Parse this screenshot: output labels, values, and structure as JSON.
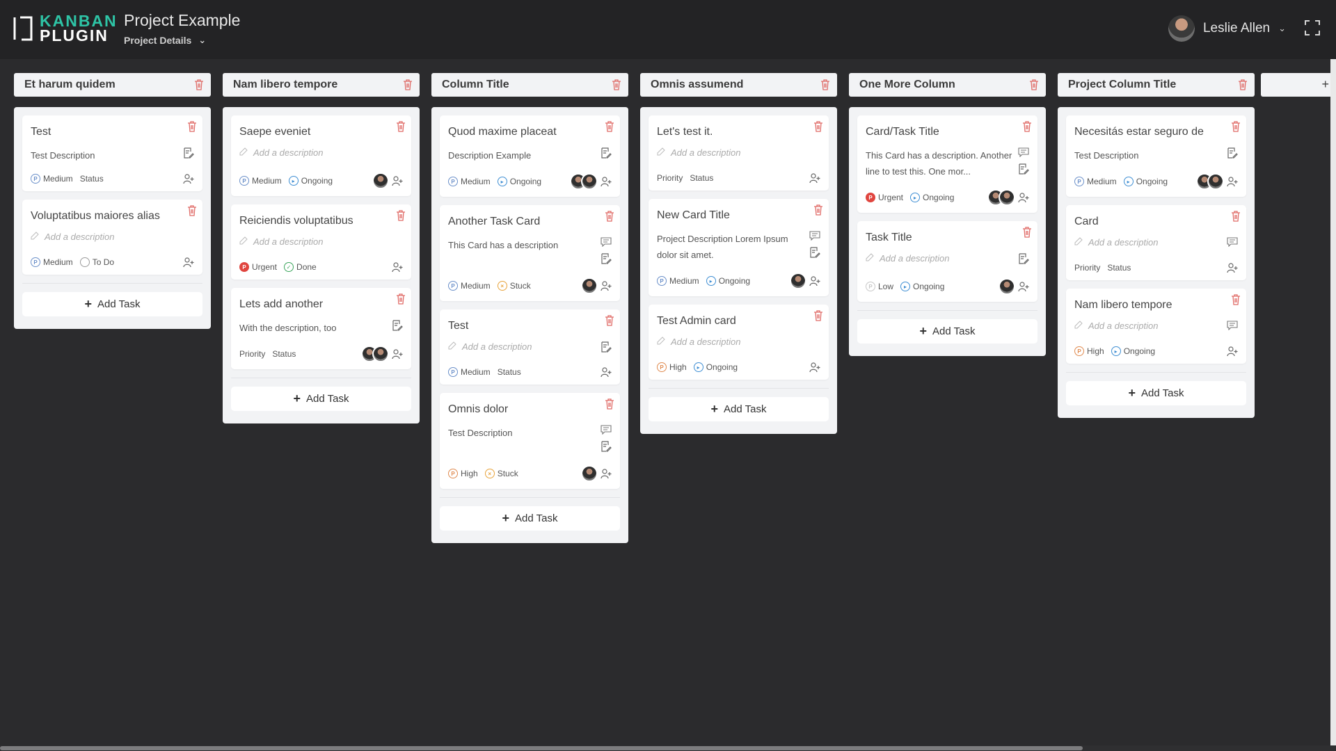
{
  "header": {
    "logo": {
      "line1": "KANBAN",
      "line2": "PLUGIN"
    },
    "project_title": "Project Example",
    "project_details": "Project Details",
    "user_name": "Leslie Allen"
  },
  "colors": {
    "background": "#2b2b2d",
    "header": "#232325",
    "accent": "#2ec4a6",
    "urgent": "#e0453f",
    "high": "#e08a4f",
    "medium": "#6a8fc9",
    "ongoing": "#3e8ed3",
    "done": "#3ba55c",
    "stuck": "#e8a33a"
  },
  "add_task_label": "Add Task",
  "placeholder_text": "Add a description",
  "columns": [
    {
      "title": "Et harum quidem",
      "cards": [
        {
          "title": "Test",
          "description": "Test Description",
          "priority": "Medium",
          "priority_level": "medium",
          "status": "Status",
          "status_level": "",
          "avatars": 0,
          "icons": [
            "note"
          ]
        },
        {
          "title": "Voluptatibus maiores alias",
          "description": "",
          "priority": "Medium",
          "priority_level": "medium",
          "status": "To Do",
          "status_level": "todo",
          "avatars": 0,
          "icons": []
        }
      ]
    },
    {
      "title": "Nam libero tempore",
      "cards": [
        {
          "title": "Saepe eveniet",
          "description": "",
          "priority": "Medium",
          "priority_level": "medium",
          "status": "Ongoing",
          "status_level": "ongoing",
          "avatars": 1,
          "icons": []
        },
        {
          "title": "Reiciendis voluptatibus",
          "description": "",
          "priority": "Urgent",
          "priority_level": "urgent",
          "status": "Done",
          "status_level": "done",
          "avatars": 0,
          "icons": []
        },
        {
          "title": "Lets add another",
          "description": "With the description, too",
          "priority": "Priority",
          "priority_level": "",
          "status": "Status",
          "status_level": "",
          "avatars": 2,
          "icons": [
            "note"
          ]
        }
      ]
    },
    {
      "title": "Column Title",
      "cards": [
        {
          "title": "Quod maxime placeat",
          "description": "Description Example",
          "priority": "Medium",
          "priority_level": "medium",
          "status": "Ongoing",
          "status_level": "ongoing",
          "avatars": 2,
          "icons": [
            "note"
          ]
        },
        {
          "title": "Another Task Card",
          "description": "This Card has a description",
          "priority": "Medium",
          "priority_level": "medium",
          "status": "Stuck",
          "status_level": "stuck",
          "avatars": 1,
          "icons": [
            "comment",
            "note"
          ]
        },
        {
          "title": "Test",
          "description": "",
          "priority": "Medium",
          "priority_level": "medium",
          "status": "Status",
          "status_level": "",
          "avatars": 0,
          "icons": [
            "note"
          ]
        },
        {
          "title": "Omnis dolor",
          "description": "Test Description",
          "priority": "High",
          "priority_level": "high",
          "status": "Stuck",
          "status_level": "stuck",
          "avatars": 1,
          "icons": [
            "comment",
            "note"
          ]
        }
      ]
    },
    {
      "title": "Omnis assumend",
      "cards": [
        {
          "title": "Let's test it.",
          "description": "",
          "priority": "Priority",
          "priority_level": "",
          "status": "Status",
          "status_level": "",
          "avatars": 0,
          "icons": []
        },
        {
          "title": "New Card Title",
          "description": "Project Description Lorem Ipsum dolor sit amet.",
          "priority": "Medium",
          "priority_level": "medium",
          "status": "Ongoing",
          "status_level": "ongoing",
          "avatars": 1,
          "icons": [
            "comment",
            "note"
          ]
        },
        {
          "title": "Test Admin card",
          "description": "",
          "priority": "High",
          "priority_level": "high",
          "status": "Ongoing",
          "status_level": "ongoing",
          "avatars": 0,
          "icons": []
        }
      ]
    },
    {
      "title": "One More Column",
      "cards": [
        {
          "title": "Card/Task Title",
          "description": "This Card has a description. Another line to test this. One mor...",
          "priority": "Urgent",
          "priority_level": "urgent",
          "status": "Ongoing",
          "status_level": "ongoing",
          "avatars": 2,
          "icons": [
            "comment",
            "note"
          ]
        },
        {
          "title": "Task Title",
          "description": "",
          "priority": "Low",
          "priority_level": "low",
          "status": "Ongoing",
          "status_level": "ongoing",
          "avatars": 1,
          "icons": [
            "note"
          ]
        }
      ]
    },
    {
      "title": "Project Column Title",
      "cards": [
        {
          "title": "Necesitás estar seguro de",
          "description": "Test Description",
          "priority": "Medium",
          "priority_level": "medium",
          "status": "Ongoing",
          "status_level": "ongoing",
          "avatars": 2,
          "icons": [
            "note"
          ]
        },
        {
          "title": "Card",
          "description": "",
          "priority": "Priority",
          "priority_level": "",
          "status": "Status",
          "status_level": "",
          "avatars": 0,
          "icons": [
            "comment"
          ]
        },
        {
          "title": "Nam libero tempore",
          "description": "",
          "priority": "High",
          "priority_level": "high",
          "status": "Ongoing",
          "status_level": "ongoing",
          "avatars": 0,
          "icons": [
            "comment"
          ]
        }
      ]
    }
  ]
}
